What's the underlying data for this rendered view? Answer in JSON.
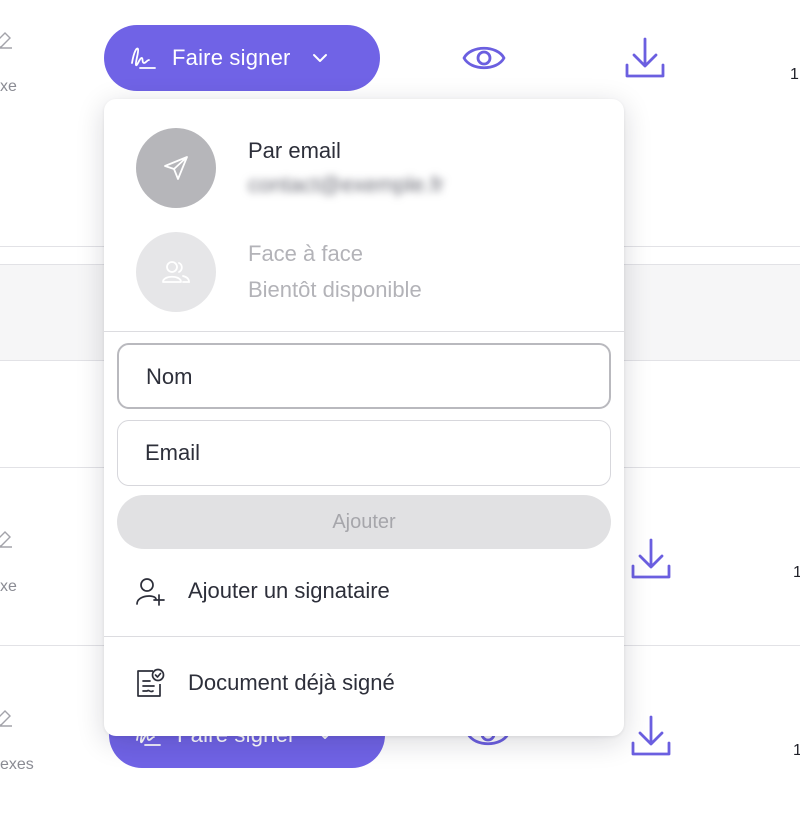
{
  "background": {
    "rows": [
      {
        "annexe_text": "xe",
        "count_text": "1"
      },
      {
        "annexe_text": "xe",
        "count_text": "1"
      },
      {
        "annexe_text": "exes",
        "count_text": "1"
      }
    ],
    "sign_button_label": "Faire signer"
  },
  "colors": {
    "accent": "#7063e6",
    "icon_purple": "#6b5fe0",
    "disabled_button": "#e1e1e3",
    "disabled_text": "#a6a6ab"
  },
  "dropdown": {
    "options": {
      "email": {
        "title": "Par email",
        "sub": "contact@exemple.fr",
        "icon": "paper-plane-icon"
      },
      "face": {
        "title": "Face à face",
        "sub": "Bientôt disponible",
        "icon": "users-icon"
      }
    },
    "name_placeholder": "Nom",
    "email_placeholder": "Email",
    "add_label": "Ajouter",
    "add_signer_label": "Ajouter un signataire",
    "already_signed_label": "Document déjà signé"
  }
}
